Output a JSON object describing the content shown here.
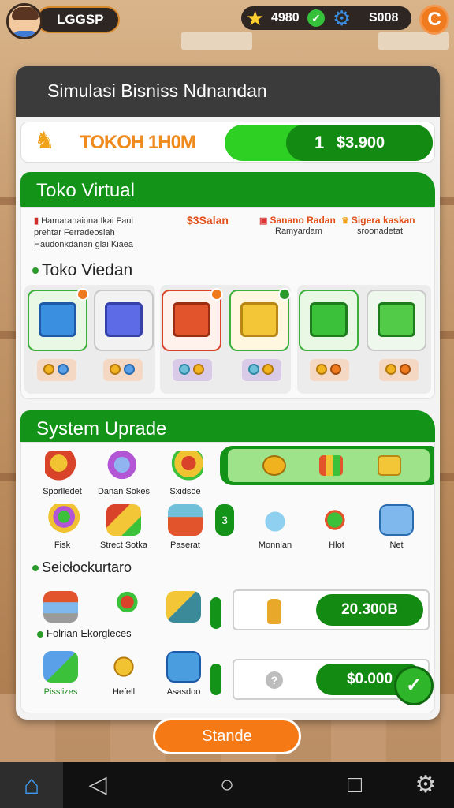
{
  "topbar": {
    "player_name": "LGGSP",
    "stars": "4980",
    "coins": "S008",
    "menu_glyph": "C"
  },
  "panel": {
    "title": "Simulasi Bisniss Ndnandan",
    "store": {
      "name": "TOKOH 1H0M",
      "level": "1",
      "money": "$3.900"
    },
    "virtual_section": {
      "heading": "Toko Virtual",
      "note": "Hamaranaiona Ikai Faui prehtar Ferradeoslah Haudonkdanan glai Kiaea",
      "sales": [
        {
          "value": "$3Salan",
          "label": ""
        },
        {
          "value": "Sanano Radan",
          "label": "Ramyardam"
        },
        {
          "value": "Sigera kaskan",
          "label": "sroonadetat"
        }
      ],
      "subheading": "Toko Viedan"
    },
    "upgrade_section": {
      "heading": "System Uprade",
      "items_row1": [
        "Sporlledet",
        "Danan Sokes",
        "Sxidsoe"
      ],
      "items_row2": [
        "Fisk",
        "Strect Sotka",
        "Paserat"
      ],
      "items_row2_right": [
        "Monnlan",
        "Hlot",
        "Net"
      ],
      "mini_tab_glyph": "3",
      "stock_title": "Seicłockurtaro",
      "value1": "20.300B",
      "foot_label": "Folrian Ekorgleces",
      "items_row4": [
        "Pisslizes",
        "Hefell",
        "Asasdoo"
      ],
      "value2": "$0.000",
      "lock_glyph": "?"
    }
  },
  "stand_button": "Stande",
  "navbar": {
    "home": "⌂",
    "back": "◁",
    "circle": "○",
    "square": "□",
    "settings": "⚙"
  },
  "colors": {
    "primary_green": "#139418",
    "bright_green": "#2fd024",
    "orange": "#f57a16",
    "dark": "#3b3b3b"
  }
}
